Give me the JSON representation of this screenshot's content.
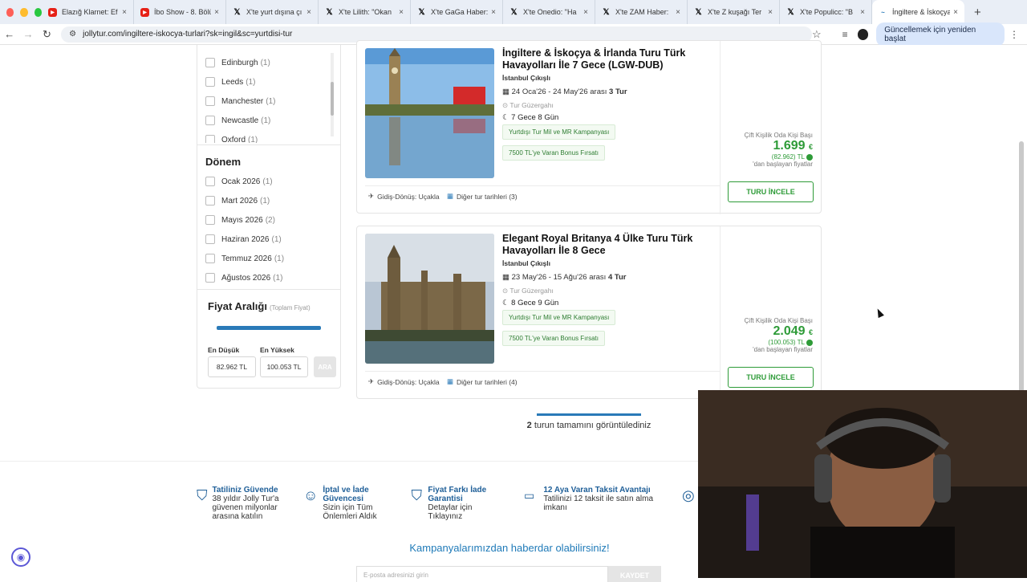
{
  "browser": {
    "tabs": [
      {
        "title": "Elazığ Klarnet: Ef",
        "icon": "youtube",
        "color": "#e62117"
      },
      {
        "title": "İbo Show - 8. Bölü",
        "icon": "youtube",
        "color": "#e62117"
      },
      {
        "title": "X'te yurt dışına çı",
        "icon": "x",
        "color": "#000000"
      },
      {
        "title": "X'te Lilith: \"Okan",
        "icon": "x",
        "color": "#000000"
      },
      {
        "title": "X'te GaGa Haber:",
        "icon": "x",
        "color": "#000000"
      },
      {
        "title": "X'te Onedio: \"Ha",
        "icon": "x",
        "color": "#000000"
      },
      {
        "title": "X'te ZAM Haber:",
        "icon": "x",
        "color": "#000000"
      },
      {
        "title": "X'te Z kuşağı Ter",
        "icon": "x",
        "color": "#000000"
      },
      {
        "title": "X'te Populicc: \"B",
        "icon": "x",
        "color": "#000000"
      },
      {
        "title": "İngiltere & İskoçya",
        "icon": "jollytur",
        "color": "#2a7ab8",
        "active": true
      }
    ],
    "url": "jollytur.com/ingiltere-iskocya-turlari?sk=ingil&sc=yurtdisi-tur",
    "update_label": "Güncellemek için yeniden başlat"
  },
  "sidebar": {
    "cities": [
      {
        "label": "Edinburgh",
        "count": "(1)"
      },
      {
        "label": "Leeds",
        "count": "(1)"
      },
      {
        "label": "Manchester",
        "count": "(1)"
      },
      {
        "label": "Newcastle",
        "count": "(1)"
      },
      {
        "label": "Oxford",
        "count": "(1)"
      }
    ],
    "period_title": "Dönem",
    "periods": [
      {
        "label": "Ocak 2026",
        "count": "(1)"
      },
      {
        "label": "Mart 2026",
        "count": "(1)"
      },
      {
        "label": "Mayıs 2026",
        "count": "(2)"
      },
      {
        "label": "Haziran 2026",
        "count": "(1)"
      },
      {
        "label": "Temmuz 2026",
        "count": "(1)"
      },
      {
        "label": "Ağustos 2026",
        "count": "(1)"
      }
    ],
    "price_title": "Fiyat Aralığı",
    "price_sub": "(Toplam Fiyat)",
    "min_label": "En Düşük",
    "max_label": "En Yüksek",
    "min_value": "82.962 TL",
    "max_value": "100.053 TL",
    "search_label": "ARA"
  },
  "tours": [
    {
      "title": "İngiltere & İskoçya & İrlanda Turu Türk Havayolları İle 7 Gece (LGW-DUB)",
      "departure": "İstanbul Çıkışlı",
      "dates": "24 Oca'26 - 24 May'26 arası",
      "tour_count": "3 Tur",
      "route": "Tur Güzergahı",
      "nights": "7 Gece 8 Gün",
      "badges": [
        "Yurtdışı Tur Mil ve MR Kampanyası",
        "7500 TL'ye Varan Bonus Fırsatı"
      ],
      "transport": "Gidiş-Dönüş: Uçakla",
      "other_dates": "Diğer tur tarihleri (3)",
      "per_person": "Çift Kişilik Oda Kişi Başı",
      "price_eur": "1.699",
      "currency": "€",
      "price_tl": "(82.962) TL",
      "starting": "'dan başlayan fiyatlar",
      "button": "TURU İNCELE"
    },
    {
      "title": "Elegant Royal Britanya 4 Ülke Turu Türk Havayolları İle 8 Gece",
      "departure": "İstanbul Çıkışlı",
      "dates": "23 May'26 - 15 Ağu'26 arası",
      "tour_count": "4 Tur",
      "route": "Tur Güzergahı",
      "nights": "8 Gece 9 Gün",
      "badges": [
        "Yurtdışı Tur Mil ve MR Kampanyası",
        "7500 TL'ye Varan Bonus Fırsatı"
      ],
      "transport": "Gidiş-Dönüş: Uçakla",
      "other_dates": "Diğer tur tarihleri (4)",
      "per_person": "Çift Kişilik Oda Kişi Başı",
      "price_eur": "2.049",
      "currency": "€",
      "price_tl": "(100.053) TL",
      "starting": "'dan başlayan fiyatlar",
      "button": "TURU İNCELE"
    }
  ],
  "viewed": {
    "count": "2",
    "text": "turun tamamını görüntülediniz"
  },
  "trust": [
    {
      "title": "Tatiliniz Güvende",
      "desc": "38 yıldır Jolly Tur'a güvenen milyonlar arasına katılın",
      "icon": "shield"
    },
    {
      "title": "İptal ve İade Güvencesi",
      "desc": "Sizin için Tüm Önlemleri Aldık",
      "icon": "person"
    },
    {
      "title": "Fiyat Farkı İade Garantisi",
      "desc": "Detaylar için Tıklayınız",
      "icon": "shield-check"
    },
    {
      "title": "12 Aya Varan Taksit Avantajı",
      "desc": "Tatilinizi 12 taksit ile satın alma imkanı",
      "icon": "card"
    }
  ],
  "newsletter": {
    "title": "Kampanyalarımızdan haberdar olabilirsiniz!",
    "placeholder": "E-posta adresinizi girin",
    "button": "KAYDET"
  }
}
